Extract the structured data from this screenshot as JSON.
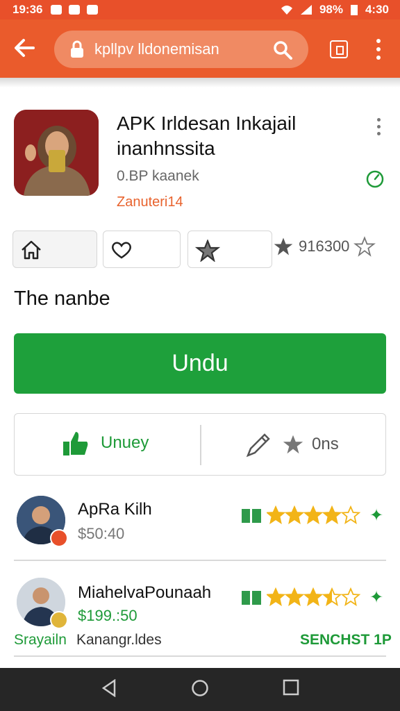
{
  "status_bar": {
    "time": "19:36",
    "battery_text": "98%",
    "right_time": "4:30"
  },
  "browser": {
    "url_text": "kpllpv lldonemisan"
  },
  "app": {
    "title": "APK Irldesan Inkajail inanhnssita",
    "developer": "0.BP kaanek",
    "category": "Zanuteri14"
  },
  "chips": {
    "rating_value": "916300"
  },
  "section_heading": "The nanbe",
  "download_label": "Undu",
  "actions": {
    "left_label": "Unuey",
    "right_label": "0ns"
  },
  "reviews": [
    {
      "name": "ApRa Kilh",
      "price": "$50:40",
      "price_color": "#777777",
      "stars": 4.0
    },
    {
      "name": "MiahelvaPounaah",
      "price": "$199.:50",
      "price_color": "#1e9a38",
      "stars": 3.5
    }
  ],
  "footer": {
    "left": "Srayailn",
    "middle": "Kanangr.ldes",
    "right": "SENCHST 1P"
  },
  "colors": {
    "brand": "#ea5b2c",
    "accent_green": "#1ea03b",
    "star": "#f2b417"
  },
  "icons": [
    "back-arrow-icon",
    "lock-icon",
    "search-icon",
    "tabs-icon",
    "more-icon",
    "home-icon",
    "heart-icon",
    "star-icon",
    "clock-icon",
    "thumbs-up-icon",
    "pen-icon",
    "ticket-icon",
    "arrow-icon",
    "nav-back-icon",
    "nav-home-icon",
    "nav-recent-icon"
  ]
}
